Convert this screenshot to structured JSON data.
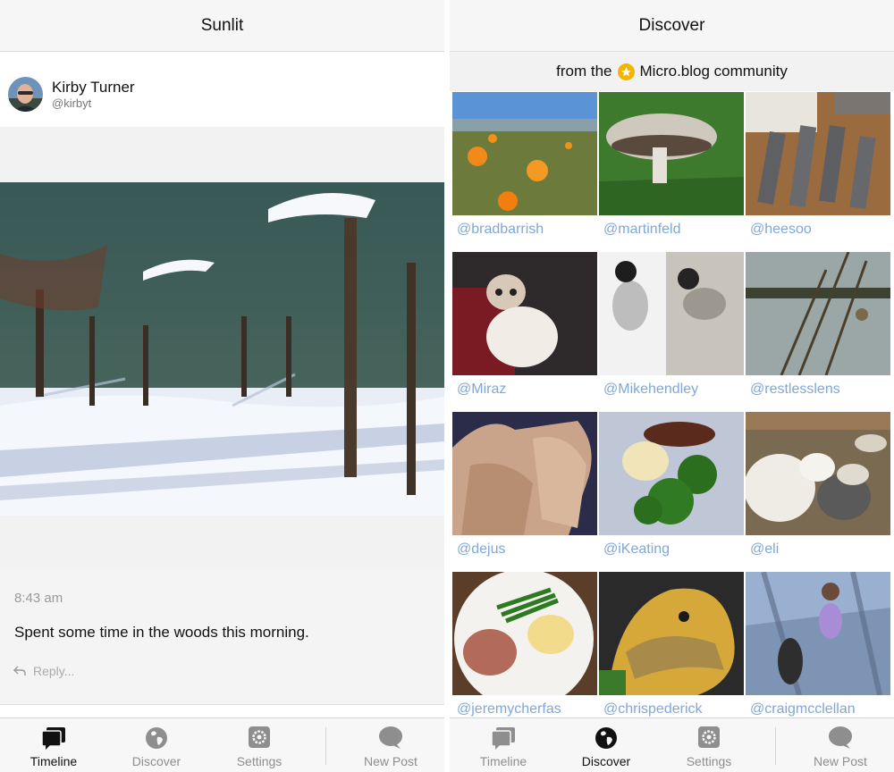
{
  "left": {
    "nav_title": "Sunlit",
    "author": {
      "name": "Kirby Turner",
      "handle": "@kirbyt"
    },
    "post": {
      "time": "8:43 am",
      "text": "Spent some time in the woods this morning.",
      "reply": "Reply..."
    }
  },
  "right": {
    "nav_title": "Discover",
    "banner": {
      "prefix": "from the",
      "suffix": "Micro.blog community"
    },
    "users": [
      "@bradbarrish",
      "@martinfeld",
      "@heesoo",
      "@Miraz",
      "@Mikehendley",
      "@restlesslens",
      "@dejus",
      "@iKeating",
      "@eli",
      "@jeremycherfas",
      "@chrispederick",
      "@craigmcclellan"
    ]
  },
  "tabs": {
    "timeline": "Timeline",
    "discover": "Discover",
    "settings": "Settings",
    "new_post": "New Post"
  },
  "colors": {
    "link": "#7fa7d8",
    "active_tab": "#111111",
    "inactive_tab": "#8e8e8e",
    "badge": "#f5b400"
  }
}
